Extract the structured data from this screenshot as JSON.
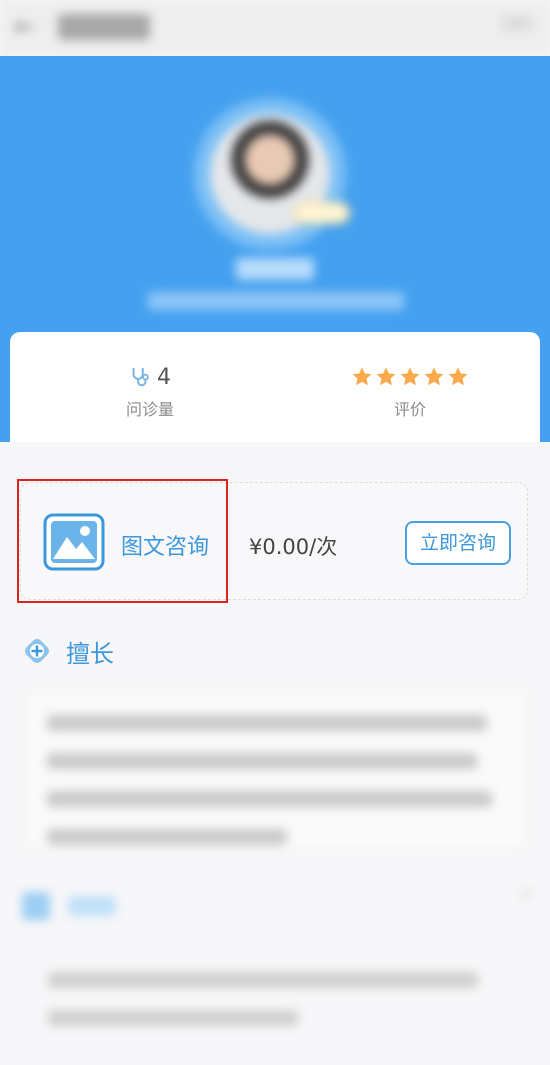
{
  "stats": {
    "consult_count": "4",
    "consult_label": "问诊量",
    "rating_label": "评价",
    "rating_stars": 5
  },
  "consult": {
    "label": "图文咨询",
    "price": "¥0.00/次",
    "button": "立即咨询"
  },
  "specialty": {
    "title": "擅长"
  },
  "colors": {
    "header_blue": "#45a1f0",
    "accent_blue": "#3c97db",
    "star_orange": "#f9a94a",
    "highlight_red": "#d9251c"
  }
}
